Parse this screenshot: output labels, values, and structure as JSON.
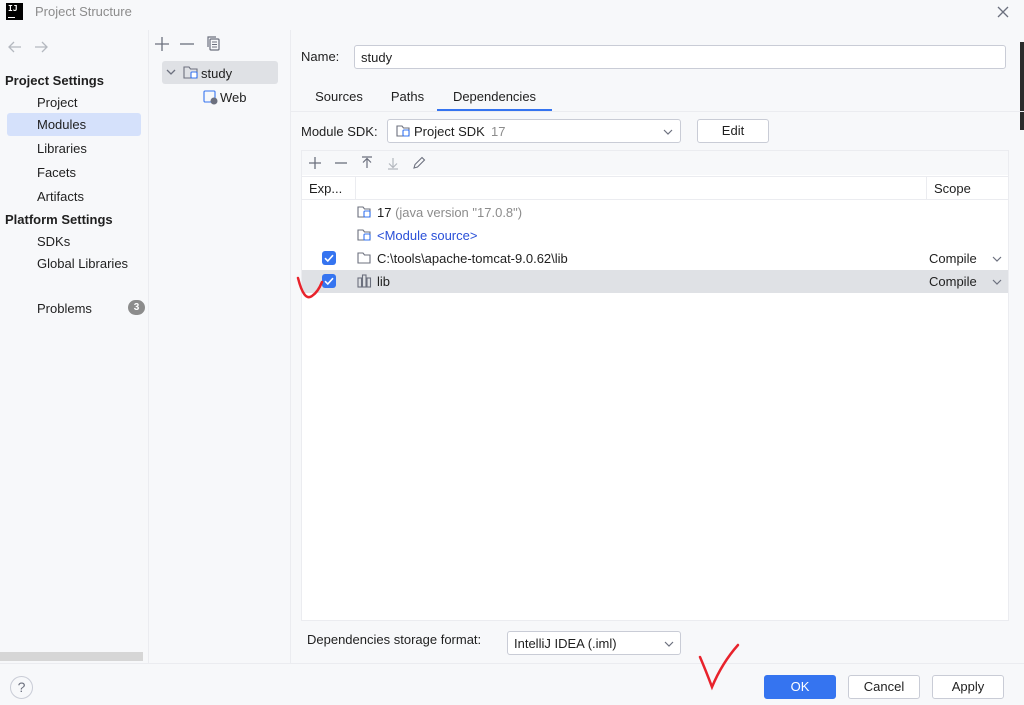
{
  "window": {
    "title": "Project Structure",
    "logo_text": "IJ"
  },
  "nav": {
    "project_settings_header": "Project Settings",
    "project_settings": [
      {
        "label": "Project",
        "selected": false
      },
      {
        "label": "Modules",
        "selected": true
      },
      {
        "label": "Libraries",
        "selected": false
      },
      {
        "label": "Facets",
        "selected": false
      },
      {
        "label": "Artifacts",
        "selected": false
      }
    ],
    "platform_settings_header": "Platform Settings",
    "platform_settings": [
      {
        "label": "SDKs"
      },
      {
        "label": "Global Libraries"
      }
    ],
    "problems": {
      "label": "Problems",
      "count": "3"
    }
  },
  "tree": {
    "items": [
      {
        "label": "study",
        "expanded": true,
        "selected": true
      },
      {
        "label": "Web"
      }
    ]
  },
  "module": {
    "name_label": "Name:",
    "name_value": "study",
    "tabs": [
      {
        "label": "Sources",
        "selected": false
      },
      {
        "label": "Paths",
        "selected": false
      },
      {
        "label": "Dependencies",
        "selected": true
      }
    ],
    "sdk_label": "Module SDK:",
    "sdk_value": "Project SDK",
    "sdk_version": "17",
    "edit_label": "Edit"
  },
  "dependencies": {
    "headers": {
      "export": "Exp...",
      "scope": "Scope"
    },
    "rows": [
      {
        "name": "17",
        "detail": "(java version \"17.0.8\")",
        "checkbox": false,
        "scope": ""
      },
      {
        "name": "<Module source>",
        "checkbox": false,
        "scope": ""
      },
      {
        "name": "C:\\tools\\apache-tomcat-9.0.62\\lib",
        "checkbox": true,
        "scope": "Compile"
      },
      {
        "name": "lib",
        "checkbox": true,
        "scope": "Compile",
        "selected": true
      }
    ],
    "storage_label": "Dependencies storage format:",
    "storage_value": "IntelliJ IDEA (.iml)"
  },
  "buttons": {
    "help": "?",
    "ok": "OK",
    "cancel": "Cancel",
    "apply": "Apply"
  },
  "colors": {
    "accent": "#3574f0",
    "selection": "#d5e1fb",
    "annotation": "#e8232c"
  }
}
